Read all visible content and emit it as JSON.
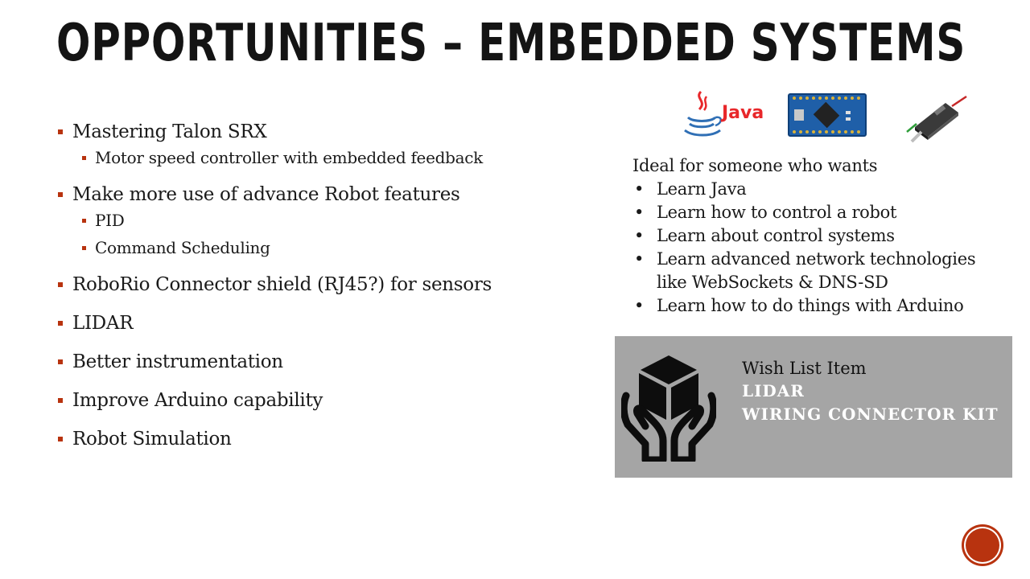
{
  "slide": {
    "title": "OPPORTUNITIES – EMBEDDED SYSTEMS"
  },
  "left_list": [
    {
      "text": "Mastering Talon SRX",
      "subs": [
        "Motor speed controller with embedded feedback"
      ]
    },
    {
      "text": "Make more use of advance Robot features",
      "subs": [
        "PID",
        "Command Scheduling"
      ]
    },
    {
      "text": "RoboRio Connector shield (RJ45?) for sensors",
      "subs": []
    },
    {
      "text": "LIDAR",
      "subs": []
    },
    {
      "text": "Better instrumentation",
      "subs": []
    },
    {
      "text": "Improve Arduino capability",
      "subs": []
    },
    {
      "text": "Robot Simulation",
      "subs": []
    }
  ],
  "logos": {
    "java_label": "Java"
  },
  "ideal": {
    "intro": "Ideal for someone who wants",
    "bullet_glyph": "•",
    "items": [
      "Learn Java",
      "Learn how to control a robot",
      "Learn about control systems",
      "Learn advanced network technologies like WebSockets & DNS-SD",
      "Learn how to do things with Arduino"
    ]
  },
  "wish": {
    "heading": "Wish List Item",
    "lines": [
      "LIDAR",
      "WIRING CONNECTOR KIT"
    ]
  },
  "icons": {
    "hands_box": "hands-holding-box-icon",
    "java": "java-logo-icon",
    "board": "arduino-board-icon",
    "robot": "robot-module-icon"
  },
  "colors": {
    "accent": "#b8330f",
    "wish_bg": "#a5a5a5",
    "java_red": "#e8272a",
    "java_blue": "#2f6fb5"
  }
}
